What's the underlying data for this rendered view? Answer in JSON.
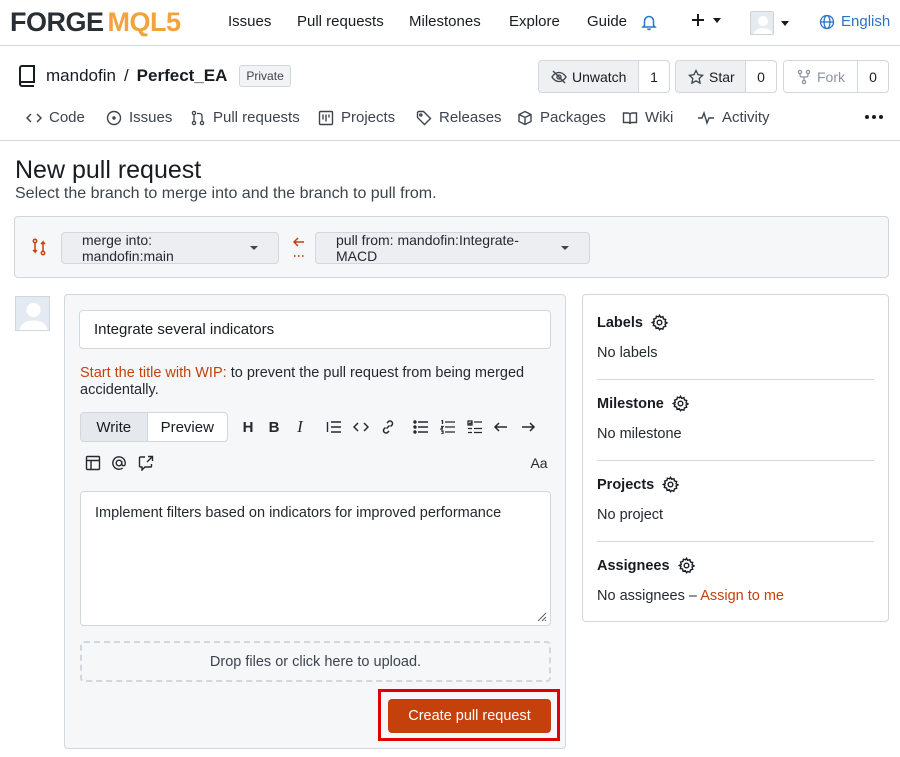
{
  "brand": {
    "left": "FORGE",
    "right": "MQL5"
  },
  "nav": {
    "items": [
      "Issues",
      "Pull requests",
      "Milestones",
      "Explore",
      "Guide"
    ],
    "language": "English"
  },
  "repo": {
    "owner": "mandofin",
    "separator": "/",
    "name": "Perfect_EA",
    "visibility": "Private",
    "unwatch_label": "Unwatch",
    "watch_count": "1",
    "star_label": "Star",
    "star_count": "0",
    "fork_label": "Fork",
    "fork_count": "0"
  },
  "tabs": [
    "Code",
    "Issues",
    "Pull requests",
    "Projects",
    "Releases",
    "Packages",
    "Wiki",
    "Activity"
  ],
  "page": {
    "title": "New pull request",
    "subtitle": "Select the branch to merge into and the branch to pull from."
  },
  "branches": {
    "merge_into": "merge into: mandofin:main",
    "pull_from": "pull from: mandofin:Integrate-MACD"
  },
  "form": {
    "title_value": "Integrate several indicators",
    "wip_prefix": "Start the title with ",
    "wip_keyword": "WIP:",
    "wip_suffix": " to prevent the pull request from being merged accidentally.",
    "tab_write": "Write",
    "tab_preview": "Preview",
    "body_value": "Implement filters based on indicators for improved performance",
    "dropzone_text": "Drop files or click here to upload.",
    "submit_label": "Create pull request",
    "toolbar_heading": "H",
    "toolbar_bold": "B",
    "toolbar_italic": "I",
    "toolbar_font": "Aa"
  },
  "sidebar": {
    "labels_title": "Labels",
    "labels_value": "No labels",
    "milestone_title": "Milestone",
    "milestone_value": "No milestone",
    "projects_title": "Projects",
    "projects_value": "No project",
    "assignees_title": "Assignees",
    "assignees_value": "No assignees –",
    "assign_link": "Assign to me"
  },
  "colors": {
    "accent": "#c4410c",
    "link_blue": "#2b73c5",
    "highlight_border": "#e10000",
    "brand_orange": "#f2a33a"
  }
}
